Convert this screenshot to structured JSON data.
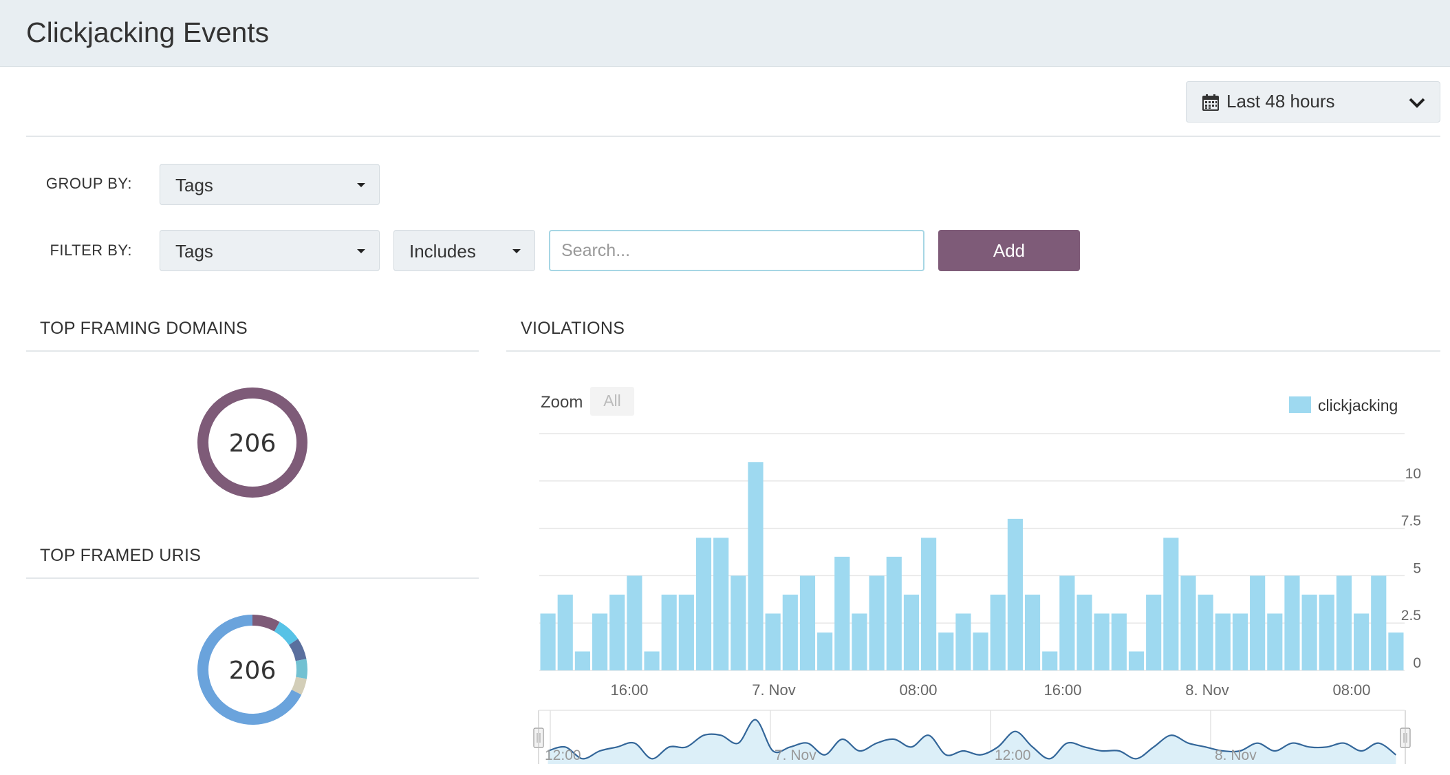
{
  "page": {
    "title": "Clickjacking Events"
  },
  "time_range": {
    "label": "Last 48 hours",
    "icon": "calendar-icon"
  },
  "group_by": {
    "label": "GROUP BY:",
    "value": "Tags"
  },
  "filter_by": {
    "label": "FILTER BY:",
    "field": "Tags",
    "operator": "Includes",
    "search_placeholder": "Search...",
    "add_label": "Add"
  },
  "panels": {
    "framing_domains": {
      "title": "TOP FRAMING DOMAINS",
      "total": "206"
    },
    "framed_uris": {
      "title": "TOP FRAMED URIS",
      "total": "206"
    },
    "violations": {
      "title": "VIOLATIONS"
    }
  },
  "colors": {
    "accent": "#7e5b78",
    "bar": "#9ed9f0",
    "navigator_line": "#336699",
    "navigator_fill": "#dceff8"
  },
  "donuts": {
    "framing_domains": [
      {
        "value": 206,
        "color": "#7e5b78"
      }
    ],
    "framed_uris": [
      {
        "value": 17,
        "color": "#7e5b78"
      },
      {
        "value": 15,
        "color": "#57c2e6"
      },
      {
        "value": 13,
        "color": "#5a6f9e"
      },
      {
        "value": 12,
        "color": "#72c1d2"
      },
      {
        "value": 10,
        "color": "#d3ceb8"
      },
      {
        "value": 139,
        "color": "#6aa3dc"
      }
    ]
  },
  "chart_data": {
    "type": "bar",
    "zoom_label": "Zoom",
    "zoom_button": "All",
    "legend": {
      "items": [
        "clickjacking"
      ],
      "placement": "top-right"
    },
    "series": [
      {
        "name": "clickjacking",
        "values": [
          3,
          4,
          1,
          3,
          4,
          5,
          1,
          4,
          4,
          7,
          7,
          5,
          11,
          3,
          4,
          5,
          2,
          6,
          3,
          5,
          6,
          4,
          7,
          2,
          3,
          2,
          4,
          8,
          4,
          1,
          5,
          4,
          3,
          3,
          1,
          4,
          7,
          5,
          4,
          3,
          3,
          5,
          3,
          5,
          4,
          4,
          5,
          3,
          5,
          2
        ]
      }
    ],
    "y_ticks": [
      "0",
      "2.5",
      "5",
      "7.5",
      "10"
    ],
    "ylim": [
      0,
      12.5
    ],
    "x_tick_labels": [
      "16:00",
      "7. Nov",
      "08:00",
      "16:00",
      "8. Nov",
      "08:00"
    ],
    "navigator_labels": [
      "12:00",
      "7. Nov",
      "12:00",
      "8. Nov"
    ],
    "grid": true
  }
}
